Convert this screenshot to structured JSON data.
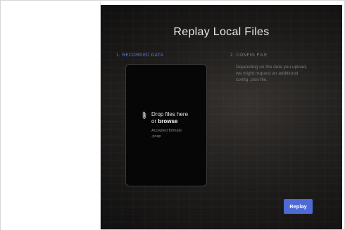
{
  "modal": {
    "title": "Replay Local Files",
    "steps": {
      "recorded": {
        "label": "1. RECORDED DATA"
      },
      "config": {
        "label": "2. CONFIG FILE",
        "description": "Depending on the data you upload, we might request an additional config .json file."
      }
    },
    "dropzone": {
      "drop_text": "Drop files here",
      "or_text": "or ",
      "browse_text": "browse",
      "accepted_label": "Accepted formats:",
      "accepted_formats": ".pcap",
      "icon": "paperclip-icon"
    },
    "replay_label": "Replay"
  },
  "colors": {
    "accent": "#4d6ad6",
    "step_active": "#6d7ff0",
    "dropzone_bg": "#060606"
  }
}
